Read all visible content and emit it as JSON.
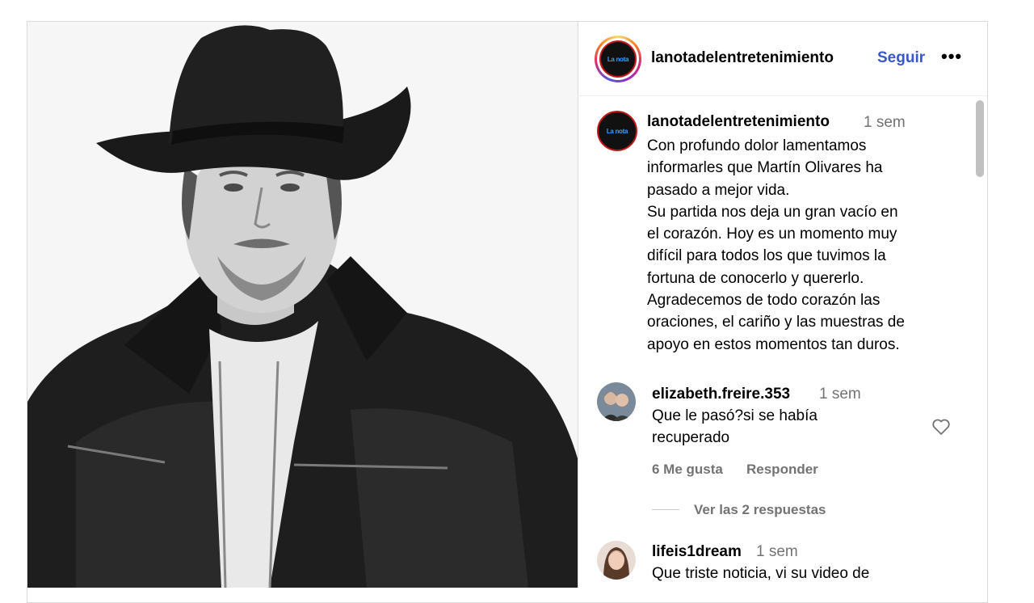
{
  "header": {
    "username": "lanotadelentretenimiento",
    "follow_label": "Seguir",
    "more_label": "•••",
    "logo_text": "La nota"
  },
  "caption": {
    "username": "lanotadelentretenimiento",
    "time": "1 sem",
    "lines": [
      "Con profundo dolor lamentamos",
      "informarles que Martín Olivares ha",
      "pasado a mejor vida.",
      "Su partida nos deja un gran vacío en",
      "el corazón. Hoy es un momento muy",
      "difícil para todos los que tuvimos la",
      "fortuna de conocerlo y quererlo.",
      "Agradecemos de todo corazón las",
      "oraciones, el cariño y las muestras de",
      "apoyo en estos momentos tan duros."
    ]
  },
  "comments": [
    {
      "username": "elizabeth.freire.353",
      "time": "1 sem",
      "lines": [
        "Que le pasó?si se había",
        "recuperado"
      ],
      "likes": "6 Me gusta",
      "reply_label": "Responder",
      "view_replies": "Ver las 2 respuestas"
    },
    {
      "username": "lifeis1dream",
      "time": "1 sem",
      "lines": [
        "Que triste noticia, vi su video de"
      ]
    }
  ],
  "colors": {
    "accent": "#3858c9",
    "secondary_text": "#737373",
    "logo_border": "#c21818"
  }
}
